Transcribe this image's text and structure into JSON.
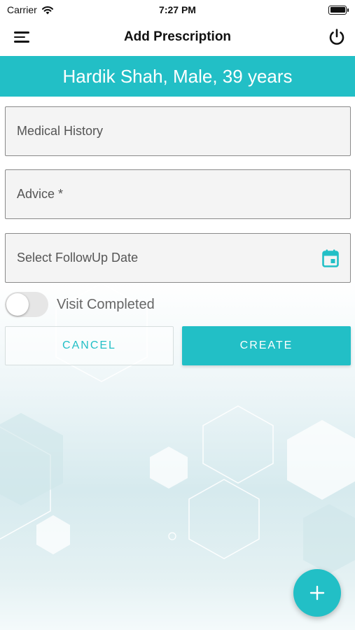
{
  "status_bar": {
    "carrier": "Carrier",
    "time": "7:27 PM"
  },
  "header": {
    "title": "Add Prescription"
  },
  "patient": {
    "summary": "Hardik Shah, Male, 39 years"
  },
  "form": {
    "medical_history": {
      "placeholder": "Medical History",
      "value": ""
    },
    "advice": {
      "placeholder": "Advice *",
      "value": ""
    },
    "followup_date": {
      "placeholder": "Select FollowUp Date",
      "value": ""
    },
    "visit_completed": {
      "label": "Visit Completed",
      "checked": false
    }
  },
  "actions": {
    "cancel_label": "CANCEL",
    "create_label": "CREATE",
    "fab_label": "+"
  },
  "icons": {
    "menu": "menu-icon",
    "power": "power-icon",
    "calendar": "calendar-icon",
    "wifi": "wifi-icon",
    "battery": "battery-icon",
    "add": "plus-icon"
  },
  "colors": {
    "accent": "#22bfc6",
    "banner_text": "#ffffff"
  }
}
